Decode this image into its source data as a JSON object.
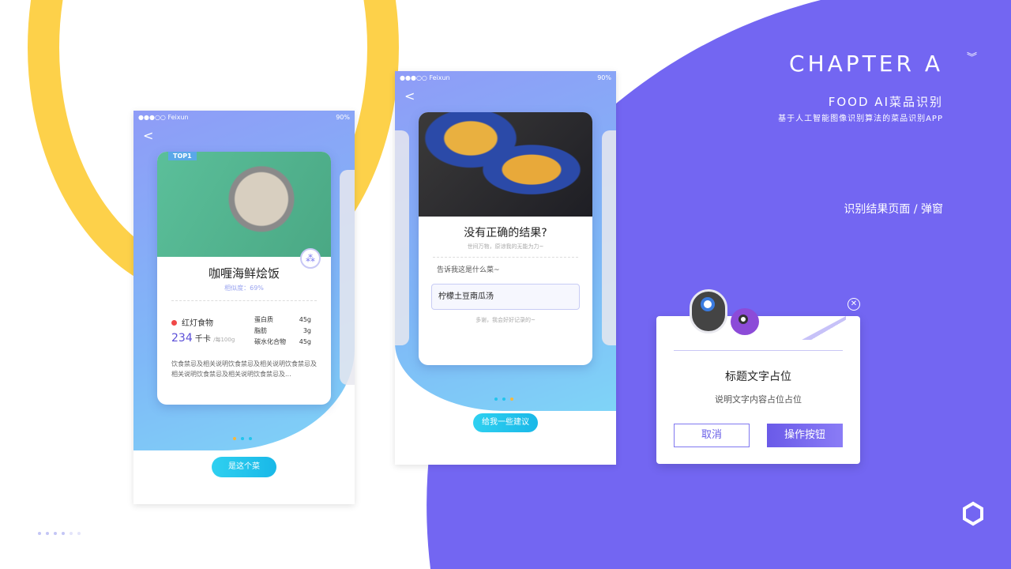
{
  "colors": {
    "purple": "#7366f2",
    "yellow": "#fdd14a",
    "cyan": "#22c4ec"
  },
  "header": {
    "chapter": "CHAPTER A",
    "chevron_icon": "double-chevron-down-icon",
    "subtitle": "FOOD AI菜品识别",
    "description": "基于人工智能图像识别算法的菜品识别APP",
    "section": "识别结果页面 / 弹窗"
  },
  "status_bar": {
    "carrier": "●●●○○ Feixun",
    "battery": "90%"
  },
  "phone1": {
    "badge": "TOP1",
    "dish": "咖喱海鲜烩饭",
    "similarity": "相似度：69%",
    "light": "红灯食物",
    "calories": "234",
    "cal_unit": "千卡",
    "per": "/每100g",
    "nutrients": [
      {
        "name": "蛋白质",
        "value": "45g"
      },
      {
        "name": "脂肪",
        "value": "3g"
      },
      {
        "name": "碳水化合物",
        "value": "45g"
      }
    ],
    "desc": "饮食禁忌及相关说明饮食禁忌及相关说明饮食禁忌及相关说明饮食禁忌及相关说明饮食禁忌及...",
    "button": "是这个菜"
  },
  "phone2": {
    "title": "没有正确的结果?",
    "subtitle": "世间万物，原谅我的无能为力~",
    "prompt": "告诉我这是什么菜~",
    "input_value": "柠檬土豆南瓜汤",
    "thanks": "多谢，我会好好记录的~",
    "button": "给我一些建议"
  },
  "popup": {
    "title": "标题文字占位",
    "message": "说明文字内容占位占位",
    "cancel": "取消",
    "confirm": "操作按钮"
  }
}
